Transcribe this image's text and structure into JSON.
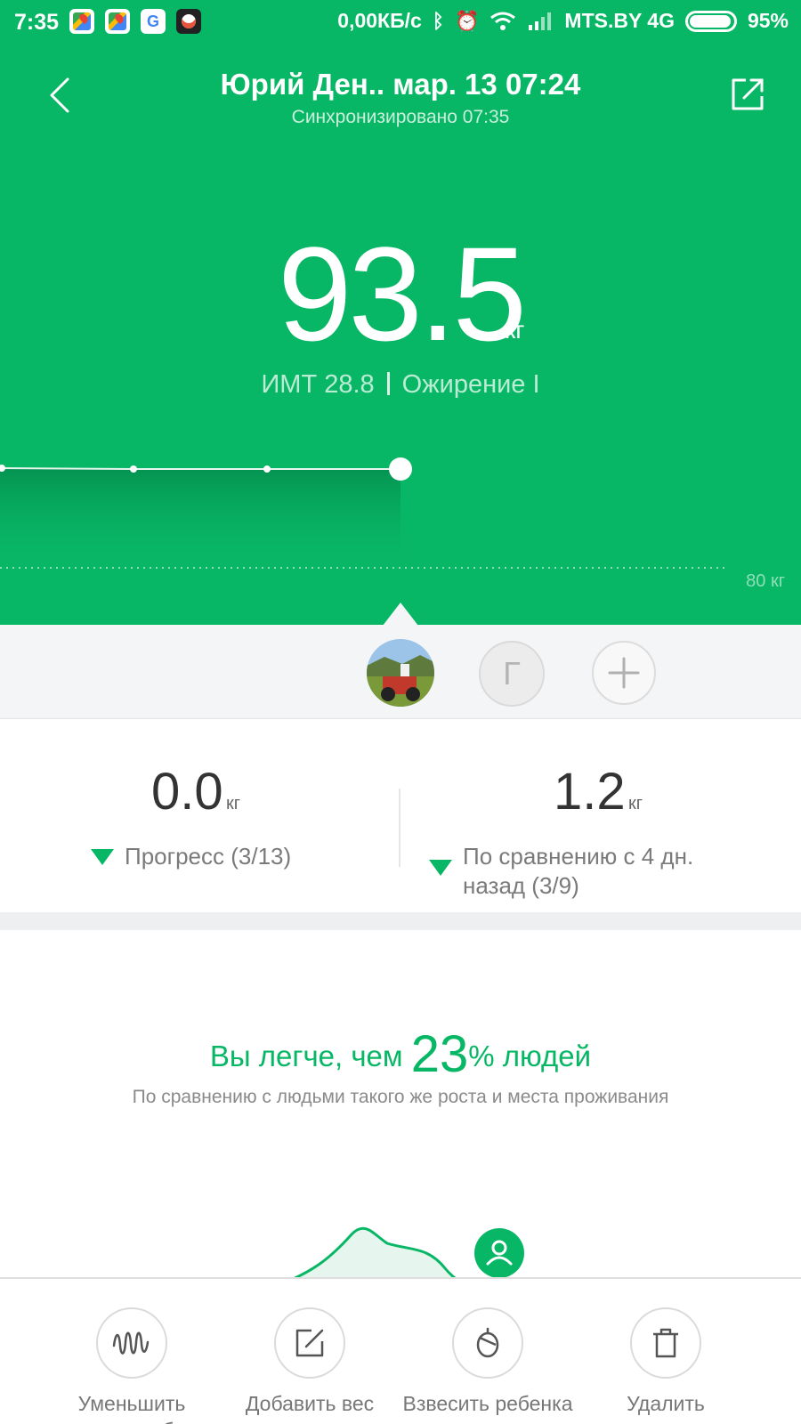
{
  "status_bar": {
    "time": "7:35",
    "net_speed": "0,00КБ/с",
    "bluetooth_icon": "ᛒ",
    "alarm_icon": "⏰",
    "carrier": "MTS.BY 4G",
    "battery": "95%",
    "battery_level": 0.95
  },
  "nav": {
    "title": "Юрий Ден.. мар. 13 07:24",
    "subtitle": "Синхронизировано 07:35"
  },
  "weight": {
    "value": "93.5",
    "unit": "кг",
    "bmi": "ИМТ 28.8",
    "category": "Ожирение I"
  },
  "trend": {
    "reference_label": "80 кг"
  },
  "users": {
    "second_initial": "Г"
  },
  "stats": {
    "progress": {
      "value": "0.0",
      "unit": "кг",
      "label": "Прогресс (3/13)"
    },
    "compare": {
      "value": "1.2",
      "unit": "кг",
      "label_line1": "По сравнению с 4 дн.",
      "label_line2": "назад (3/9)"
    }
  },
  "comparison": {
    "prefix": "Вы легче, чем ",
    "percent": "23",
    "suffix": "% людей",
    "subtitle": "По сравнению с людьми такого же роста и места проживания"
  },
  "actions": [
    {
      "label": "Уменьшить масштаб",
      "icon": "zoom-out-wave-icon"
    },
    {
      "label": "Добавить вес",
      "icon": "edit-icon"
    },
    {
      "label": "Взвесить ребенка",
      "icon": "baby-scale-icon"
    },
    {
      "label": "Удалить",
      "icon": "trash-icon"
    }
  ],
  "colors": {
    "accent": "#08b765",
    "selector_bg": "#f3f5f6"
  }
}
